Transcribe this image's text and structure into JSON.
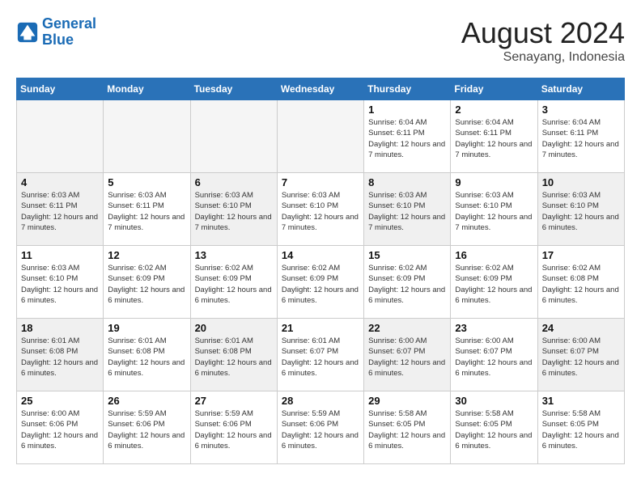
{
  "logo": {
    "line1": "General",
    "line2": "Blue"
  },
  "title": "August 2024",
  "subtitle": "Senayang, Indonesia",
  "days_of_week": [
    "Sunday",
    "Monday",
    "Tuesday",
    "Wednesday",
    "Thursday",
    "Friday",
    "Saturday"
  ],
  "weeks": [
    [
      {
        "day": "",
        "info": ""
      },
      {
        "day": "",
        "info": ""
      },
      {
        "day": "",
        "info": ""
      },
      {
        "day": "",
        "info": ""
      },
      {
        "day": "1",
        "info": "Sunrise: 6:04 AM\nSunset: 6:11 PM\nDaylight: 12 hours\nand 7 minutes."
      },
      {
        "day": "2",
        "info": "Sunrise: 6:04 AM\nSunset: 6:11 PM\nDaylight: 12 hours\nand 7 minutes."
      },
      {
        "day": "3",
        "info": "Sunrise: 6:04 AM\nSunset: 6:11 PM\nDaylight: 12 hours\nand 7 minutes."
      }
    ],
    [
      {
        "day": "4",
        "info": "Sunrise: 6:03 AM\nSunset: 6:11 PM\nDaylight: 12 hours\nand 7 minutes."
      },
      {
        "day": "5",
        "info": "Sunrise: 6:03 AM\nSunset: 6:11 PM\nDaylight: 12 hours\nand 7 minutes."
      },
      {
        "day": "6",
        "info": "Sunrise: 6:03 AM\nSunset: 6:10 PM\nDaylight: 12 hours\nand 7 minutes."
      },
      {
        "day": "7",
        "info": "Sunrise: 6:03 AM\nSunset: 6:10 PM\nDaylight: 12 hours\nand 7 minutes."
      },
      {
        "day": "8",
        "info": "Sunrise: 6:03 AM\nSunset: 6:10 PM\nDaylight: 12 hours\nand 7 minutes."
      },
      {
        "day": "9",
        "info": "Sunrise: 6:03 AM\nSunset: 6:10 PM\nDaylight: 12 hours\nand 7 minutes."
      },
      {
        "day": "10",
        "info": "Sunrise: 6:03 AM\nSunset: 6:10 PM\nDaylight: 12 hours\nand 6 minutes."
      }
    ],
    [
      {
        "day": "11",
        "info": "Sunrise: 6:03 AM\nSunset: 6:10 PM\nDaylight: 12 hours\nand 6 minutes."
      },
      {
        "day": "12",
        "info": "Sunrise: 6:02 AM\nSunset: 6:09 PM\nDaylight: 12 hours\nand 6 minutes."
      },
      {
        "day": "13",
        "info": "Sunrise: 6:02 AM\nSunset: 6:09 PM\nDaylight: 12 hours\nand 6 minutes."
      },
      {
        "day": "14",
        "info": "Sunrise: 6:02 AM\nSunset: 6:09 PM\nDaylight: 12 hours\nand 6 minutes."
      },
      {
        "day": "15",
        "info": "Sunrise: 6:02 AM\nSunset: 6:09 PM\nDaylight: 12 hours\nand 6 minutes."
      },
      {
        "day": "16",
        "info": "Sunrise: 6:02 AM\nSunset: 6:09 PM\nDaylight: 12 hours\nand 6 minutes."
      },
      {
        "day": "17",
        "info": "Sunrise: 6:02 AM\nSunset: 6:08 PM\nDaylight: 12 hours\nand 6 minutes."
      }
    ],
    [
      {
        "day": "18",
        "info": "Sunrise: 6:01 AM\nSunset: 6:08 PM\nDaylight: 12 hours\nand 6 minutes."
      },
      {
        "day": "19",
        "info": "Sunrise: 6:01 AM\nSunset: 6:08 PM\nDaylight: 12 hours\nand 6 minutes."
      },
      {
        "day": "20",
        "info": "Sunrise: 6:01 AM\nSunset: 6:08 PM\nDaylight: 12 hours\nand 6 minutes."
      },
      {
        "day": "21",
        "info": "Sunrise: 6:01 AM\nSunset: 6:07 PM\nDaylight: 12 hours\nand 6 minutes."
      },
      {
        "day": "22",
        "info": "Sunrise: 6:00 AM\nSunset: 6:07 PM\nDaylight: 12 hours\nand 6 minutes."
      },
      {
        "day": "23",
        "info": "Sunrise: 6:00 AM\nSunset: 6:07 PM\nDaylight: 12 hours\nand 6 minutes."
      },
      {
        "day": "24",
        "info": "Sunrise: 6:00 AM\nSunset: 6:07 PM\nDaylight: 12 hours\nand 6 minutes."
      }
    ],
    [
      {
        "day": "25",
        "info": "Sunrise: 6:00 AM\nSunset: 6:06 PM\nDaylight: 12 hours\nand 6 minutes."
      },
      {
        "day": "26",
        "info": "Sunrise: 5:59 AM\nSunset: 6:06 PM\nDaylight: 12 hours\nand 6 minutes."
      },
      {
        "day": "27",
        "info": "Sunrise: 5:59 AM\nSunset: 6:06 PM\nDaylight: 12 hours\nand 6 minutes."
      },
      {
        "day": "28",
        "info": "Sunrise: 5:59 AM\nSunset: 6:06 PM\nDaylight: 12 hours\nand 6 minutes."
      },
      {
        "day": "29",
        "info": "Sunrise: 5:58 AM\nSunset: 6:05 PM\nDaylight: 12 hours\nand 6 minutes."
      },
      {
        "day": "30",
        "info": "Sunrise: 5:58 AM\nSunset: 6:05 PM\nDaylight: 12 hours\nand 6 minutes."
      },
      {
        "day": "31",
        "info": "Sunrise: 5:58 AM\nSunset: 6:05 PM\nDaylight: 12 hours\nand 6 minutes."
      }
    ]
  ]
}
